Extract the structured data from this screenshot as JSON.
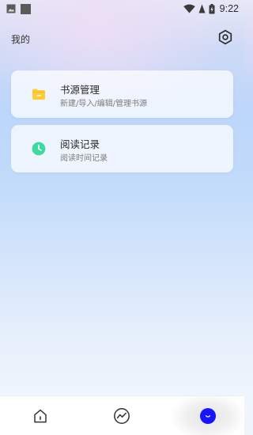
{
  "status_bar": {
    "time": "9:22",
    "icons": [
      "gallery-notification-icon",
      "app-notification-icon",
      "wifi-icon",
      "battery-charging-icon"
    ]
  },
  "header": {
    "title": "我的",
    "settings_icon": "gear-icon"
  },
  "menu": [
    {
      "title": "书源管理",
      "subtitle": "新建/导入/编辑/管理书源",
      "icon": "folder-icon",
      "icon_color": "#ffcc33"
    },
    {
      "title": "阅读记录",
      "subtitle": "阅读时间记录",
      "icon": "clock-icon",
      "icon_color": "#3ed9a0"
    }
  ],
  "bottom_nav": {
    "items": [
      {
        "icon": "home-icon",
        "active": false
      },
      {
        "icon": "trend-icon",
        "active": false
      },
      {
        "icon": "profile-icon",
        "active": true,
        "color": "#1515ff"
      }
    ]
  }
}
